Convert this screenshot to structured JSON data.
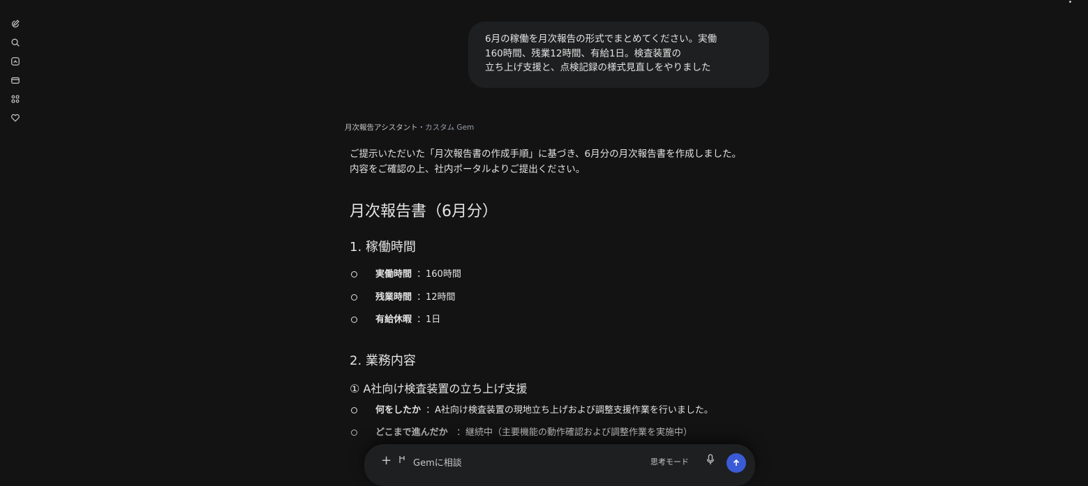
{
  "sidebar": {
    "items": [
      {
        "icon": "new-chat-icon"
      },
      {
        "icon": "search-icon"
      },
      {
        "icon": "gem-manager-icon"
      },
      {
        "icon": "tools-icon"
      },
      {
        "icon": "apps-icon"
      },
      {
        "icon": "heart-icon"
      }
    ]
  },
  "user_message": {
    "lines": [
      "6月の稼働を月次報告の形式でまとめてください。実働",
      "160時間、残業12時間、有給1日。検査装置の",
      "立ち上げ支援と、点検記録の様式見直しをやりました"
    ]
  },
  "gem": {
    "name": "月次報告アシスタント",
    "separator": "・",
    "type": "カスタム Gem"
  },
  "response": {
    "intro": [
      "ご提示いただいた「月次報告書の作成手順」に基づき、6月分の月次報告書を作成しました。",
      "内容をご確認の上、社内ポータルよりご提出ください。"
    ],
    "title": "月次報告書（6月分）",
    "section1": {
      "heading": "1. 稼働時間",
      "items": [
        {
          "label": "実働時間",
          "value": "：160時間"
        },
        {
          "label": "残業時間",
          "value": "：12時間"
        },
        {
          "label": "有給休暇",
          "value": "：1日"
        }
      ]
    },
    "section2": {
      "heading": "2. 業務内容",
      "sub1": {
        "heading": "① A社向け検査装置の立ち上げ支援",
        "items": [
          {
            "label": "何をしたか",
            "value": "：A社向け検査装置の現地立ち上げおよび調整支援作業を行いました。"
          },
          {
            "label": "どこまで進んだか",
            "value": "：継続中（主要機能の動作確認および調整作業を実施中）"
          }
        ]
      }
    }
  },
  "input": {
    "placeholder": "Gemに相談",
    "mode_label": "思考モード"
  },
  "colors": {
    "background": "#131314",
    "bubble": "#1e1f20",
    "send_button": "#3b5bd6"
  }
}
